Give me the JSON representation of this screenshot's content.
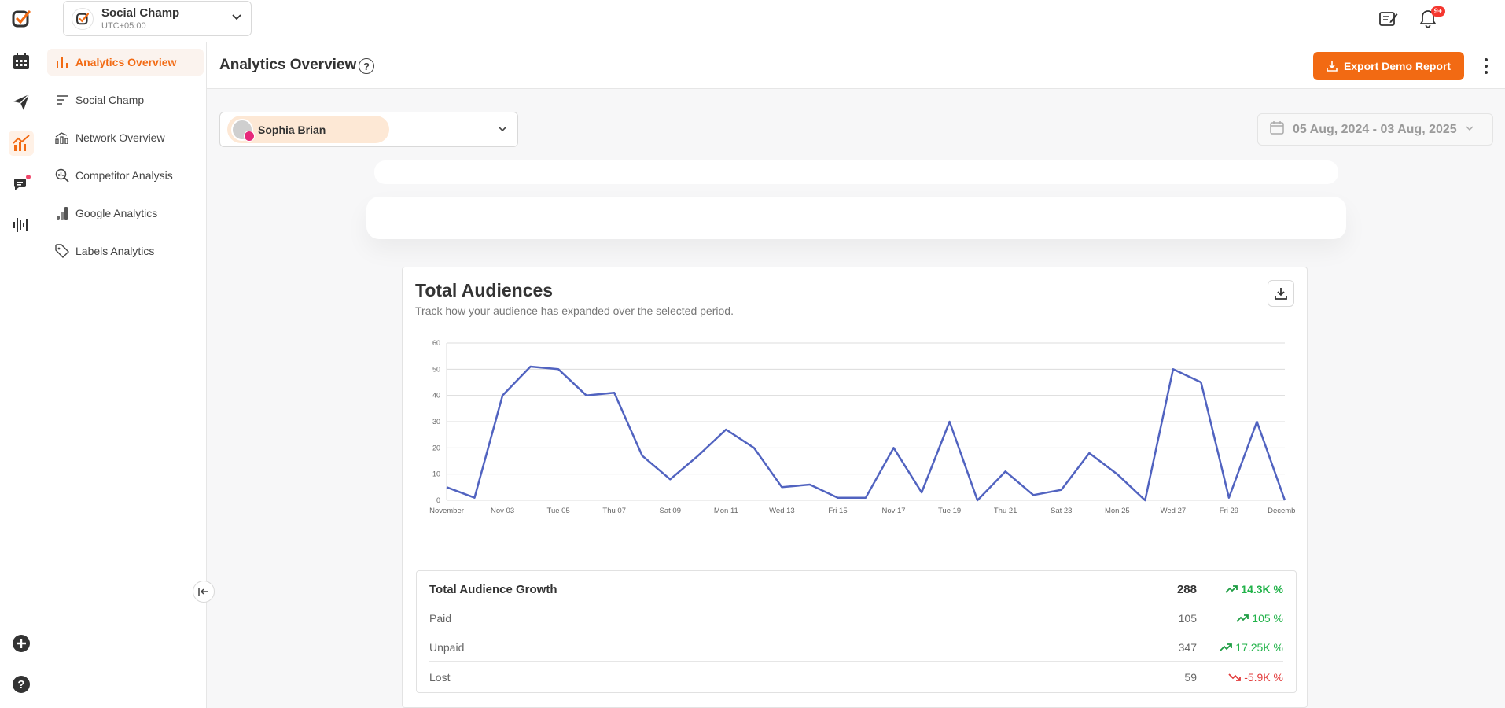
{
  "workspace": {
    "name": "Social Champ",
    "timezone": "UTC+05:00"
  },
  "notifications": {
    "badge": "9+"
  },
  "sidebar": {
    "items": [
      {
        "label": "Analytics Overview"
      },
      {
        "label": "Social Champ"
      },
      {
        "label": "Network Overview"
      },
      {
        "label": "Competitor Analysis"
      },
      {
        "label": "Google Analytics"
      },
      {
        "label": "Labels Analytics"
      }
    ]
  },
  "header": {
    "title": "Analytics Overview",
    "help": "?",
    "export_label": "Export Demo Report"
  },
  "filters": {
    "account_name": "Sophia Brian",
    "date_range": "05 Aug, 2024 - 03 Aug, 2025"
  },
  "card": {
    "title": "Total Audiences",
    "subtitle": "Track how your audience has expanded over the selected period."
  },
  "colors": {
    "accent": "#f26a13",
    "line": "#5163c0",
    "up": "#22b34a",
    "down": "#e23b3b"
  },
  "chart_data": {
    "type": "line",
    "ylim": [
      0,
      60
    ],
    "yticks": [
      0,
      10,
      20,
      30,
      40,
      50,
      60
    ],
    "x_tick_labels": [
      "November",
      "Nov 03",
      "Tue 05",
      "Thu 07",
      "Sat 09",
      "Mon 11",
      "Wed 13",
      "Fri 15",
      "Nov 17",
      "Tue 19",
      "Thu 21",
      "Sat 23",
      "Mon 25",
      "Wed 27",
      "Fri 29",
      "December"
    ],
    "values": [
      5,
      1,
      40,
      51,
      50,
      40,
      41,
      17,
      8,
      17,
      27,
      20,
      5,
      6,
      1,
      1,
      20,
      3,
      30,
      0,
      11,
      2,
      4,
      18,
      10,
      0,
      50,
      45,
      1,
      30,
      0
    ],
    "grid": true
  },
  "growth_table": {
    "rows": [
      {
        "label": "Total Audience Growth",
        "value": "288",
        "change": "14.3K %",
        "trend": "up"
      },
      {
        "label": "Paid",
        "value": "105",
        "change": "105 %",
        "trend": "up"
      },
      {
        "label": "Unpaid",
        "value": "347",
        "change": "17.25K %",
        "trend": "up"
      },
      {
        "label": "Lost",
        "value": "59",
        "change": "-5.9K %",
        "trend": "down"
      }
    ]
  }
}
